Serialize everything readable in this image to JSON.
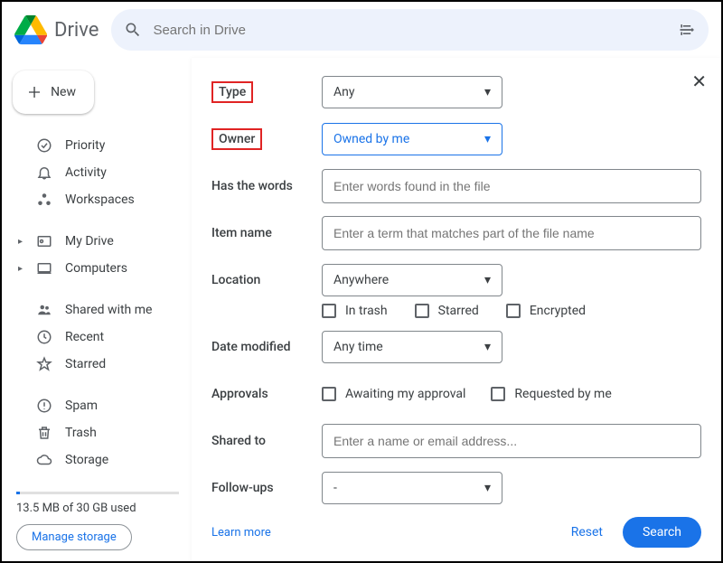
{
  "header": {
    "app_name": "Drive",
    "search_placeholder": "Search in Drive"
  },
  "sidebar": {
    "new_label": "New",
    "items_primary": [
      {
        "icon": "check-circle",
        "label": "Priority"
      },
      {
        "icon": "bell",
        "label": "Activity"
      },
      {
        "icon": "workspaces",
        "label": "Workspaces"
      }
    ],
    "items_drives": [
      {
        "icon": "mydrive",
        "label": "My Drive",
        "expandable": true
      },
      {
        "icon": "computers",
        "label": "Computers",
        "expandable": true
      }
    ],
    "items_views": [
      {
        "icon": "shared",
        "label": "Shared with me"
      },
      {
        "icon": "recent",
        "label": "Recent"
      },
      {
        "icon": "star",
        "label": "Starred"
      }
    ],
    "items_more": [
      {
        "icon": "spam",
        "label": "Spam"
      },
      {
        "icon": "trash",
        "label": "Trash"
      },
      {
        "icon": "cloud",
        "label": "Storage"
      }
    ],
    "storage_text": "13.5 MB of 30 GB used",
    "manage_label": "Manage storage"
  },
  "panel": {
    "fields": {
      "type": {
        "label": "Type",
        "value": "Any",
        "highlight": true
      },
      "owner": {
        "label": "Owner",
        "value": "Owned by me",
        "highlight": true,
        "active": true
      },
      "has_words": {
        "label": "Has the words",
        "placeholder": "Enter words found in the file"
      },
      "item_name": {
        "label": "Item name",
        "placeholder": "Enter a term that matches part of the file name"
      },
      "location": {
        "label": "Location",
        "value": "Anywhere"
      },
      "location_checks": [
        {
          "label": "In trash"
        },
        {
          "label": "Starred"
        },
        {
          "label": "Encrypted"
        }
      ],
      "date_modified": {
        "label": "Date modified",
        "value": "Any time"
      },
      "approvals": {
        "label": "Approvals",
        "checks": [
          {
            "label": "Awaiting my approval"
          },
          {
            "label": "Requested by me"
          }
        ]
      },
      "shared_to": {
        "label": "Shared to",
        "placeholder": "Enter a name or email address..."
      },
      "followups": {
        "label": "Follow-ups",
        "value": "-"
      }
    },
    "learn_more": "Learn more",
    "reset": "Reset",
    "search": "Search"
  }
}
